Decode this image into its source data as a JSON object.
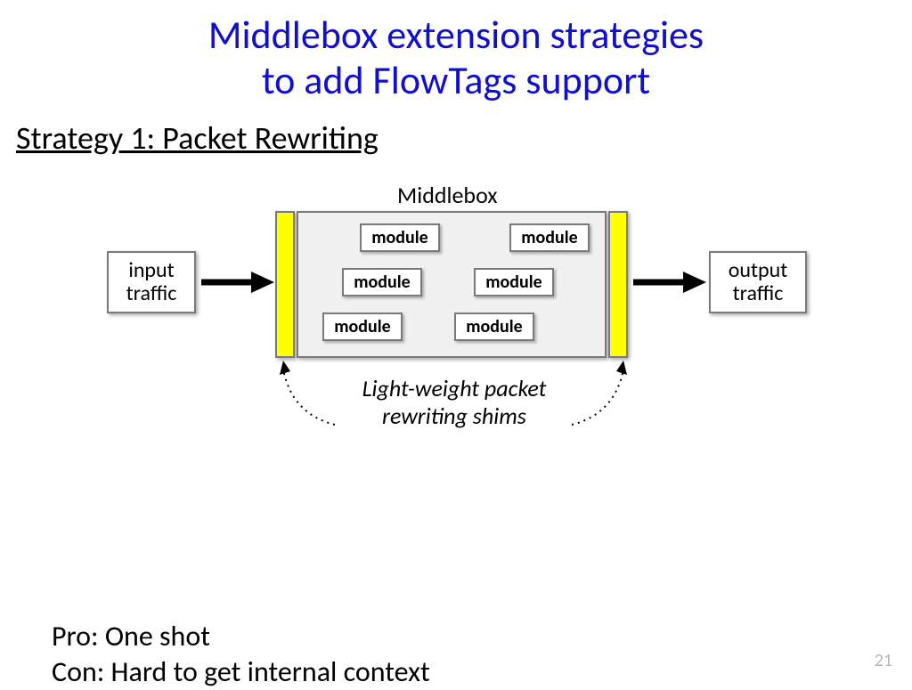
{
  "title_line1": "Middlebox extension strategies",
  "title_line2": "to add FlowTags support",
  "strategy_label": "Strategy 1: Packet Rewriting",
  "input_traffic": "input\ntraffic",
  "output_traffic": "output\ntraffic",
  "middlebox_label": "Middlebox",
  "modules": [
    "module",
    "module",
    "module",
    "module",
    "module",
    "module"
  ],
  "shim_caption_line1": "Light-weight packet",
  "shim_caption_line2": "rewriting shims",
  "pro": "Pro: One shot",
  "con": "Con: Hard to get internal context",
  "page_number": "21"
}
